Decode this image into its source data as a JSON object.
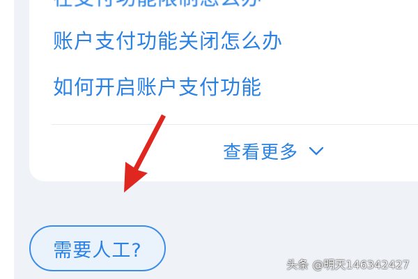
{
  "faq": {
    "items": [
      {
        "label": "在支付功能限制怎么办"
      },
      {
        "label": "账户支付功能关闭怎么办"
      },
      {
        "label": "如何开启账户支付功能"
      }
    ],
    "more_label": "查看更多"
  },
  "actions": {
    "human_label": "需要人工?"
  },
  "watermark": {
    "text": "头条 @明天146342427"
  },
  "colors": {
    "accent": "#2a82e4",
    "arrow": "#e0271f",
    "background": "#eff2f7",
    "card": "#ffffff"
  },
  "icons": {
    "more": "chevron-down-icon",
    "pointer": "red-arrow-icon"
  }
}
